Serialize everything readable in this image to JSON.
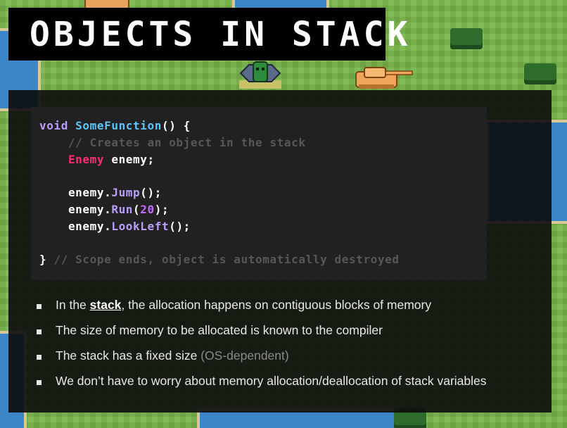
{
  "slide": {
    "title": "OBJECTS IN STACK"
  },
  "code": {
    "line1": {
      "keyword": "void",
      "function": "SomeFunction",
      "rest": "() {"
    },
    "line2": {
      "comment": "// Creates an object in the stack"
    },
    "line3": {
      "type": "Enemy",
      "rest": " enemy;"
    },
    "line4": {
      "object": "enemy",
      "dot": ".",
      "method": "Jump",
      "rest": "();"
    },
    "line5": {
      "object": "enemy",
      "dot": ".",
      "method": "Run",
      "open": "(",
      "number": "20",
      "rest": ");"
    },
    "line6": {
      "object": "enemy",
      "dot": ".",
      "method": "LookLeft",
      "rest": "();"
    },
    "line7": {
      "brace": "}",
      "comment": " // Scope ends, object is automatically destroyed"
    }
  },
  "bullets": [
    {
      "before": "In the ",
      "emph": "stack",
      "after": ", the allocation happens on contiguous blocks of memory"
    },
    {
      "text": "The size of memory to be allocated is known to the compiler"
    },
    {
      "text": "The stack has a fixed size ",
      "dim": "(OS-dependent)"
    },
    {
      "text": "We don’t have to worry about memory allocation/deallocation of stack variables"
    }
  ],
  "colors": {
    "keyword": "#b9a0ff",
    "function": "#5ec4ff",
    "type": "#ff2d72",
    "number": "#c36bff",
    "comment": "#575757",
    "panel_bg": "#0c0c0c",
    "code_bg": "#212121"
  },
  "background": {
    "icons": [
      "enemy-sprite-icon",
      "tank-sprite-icon"
    ]
  }
}
